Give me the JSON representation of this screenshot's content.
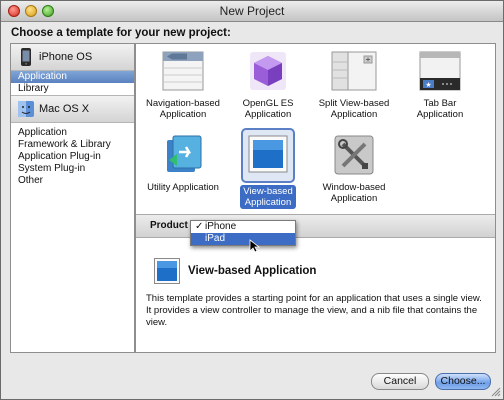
{
  "window": {
    "title": "New Project"
  },
  "heading": "Choose a template for your new project:",
  "sidebar": {
    "categories": [
      {
        "name": "iPhone OS",
        "icon": "iphone-icon",
        "items": [
          {
            "label": "Application",
            "selected": true
          },
          {
            "label": "Library",
            "selected": false
          }
        ]
      },
      {
        "name": "Mac OS X",
        "icon": "mac-os-x-icon",
        "items": [
          {
            "label": "Application",
            "selected": false
          },
          {
            "label": "Framework & Library",
            "selected": false
          },
          {
            "label": "Application Plug-in",
            "selected": false
          },
          {
            "label": "System Plug-in",
            "selected": false
          },
          {
            "label": "Other",
            "selected": false
          }
        ]
      }
    ]
  },
  "templates": [
    {
      "label": "Navigation-based Application",
      "icon": "navigation-app-icon",
      "selected": false
    },
    {
      "label": "OpenGL ES Application",
      "icon": "opengl-cube-icon",
      "selected": false
    },
    {
      "label": "Split View-based Application",
      "icon": "split-view-icon",
      "selected": false
    },
    {
      "label": "Tab Bar Application",
      "icon": "tab-bar-icon",
      "selected": false
    },
    {
      "label": "Utility Application",
      "icon": "utility-app-icon",
      "selected": false
    },
    {
      "label": "View-based Application",
      "icon": "view-based-icon",
      "selected": true
    },
    {
      "label": "Window-based Application",
      "icon": "window-tools-icon",
      "selected": false
    }
  ],
  "product": {
    "label": "Product",
    "options": [
      {
        "label": "iPhone",
        "checked": true,
        "highlighted": false
      },
      {
        "label": "iPad",
        "checked": false,
        "highlighted": true
      }
    ]
  },
  "detail": {
    "title": "View-based Application",
    "description": "This template provides a starting point for an application that uses a single view. It provides a view controller to manage the view, and a nib file that contains the view."
  },
  "buttons": {
    "cancel": "Cancel",
    "choose": "Choose..."
  },
  "colors": {
    "selection": "#3d6cc5",
    "sidebar_selection": "#6a8fca"
  }
}
